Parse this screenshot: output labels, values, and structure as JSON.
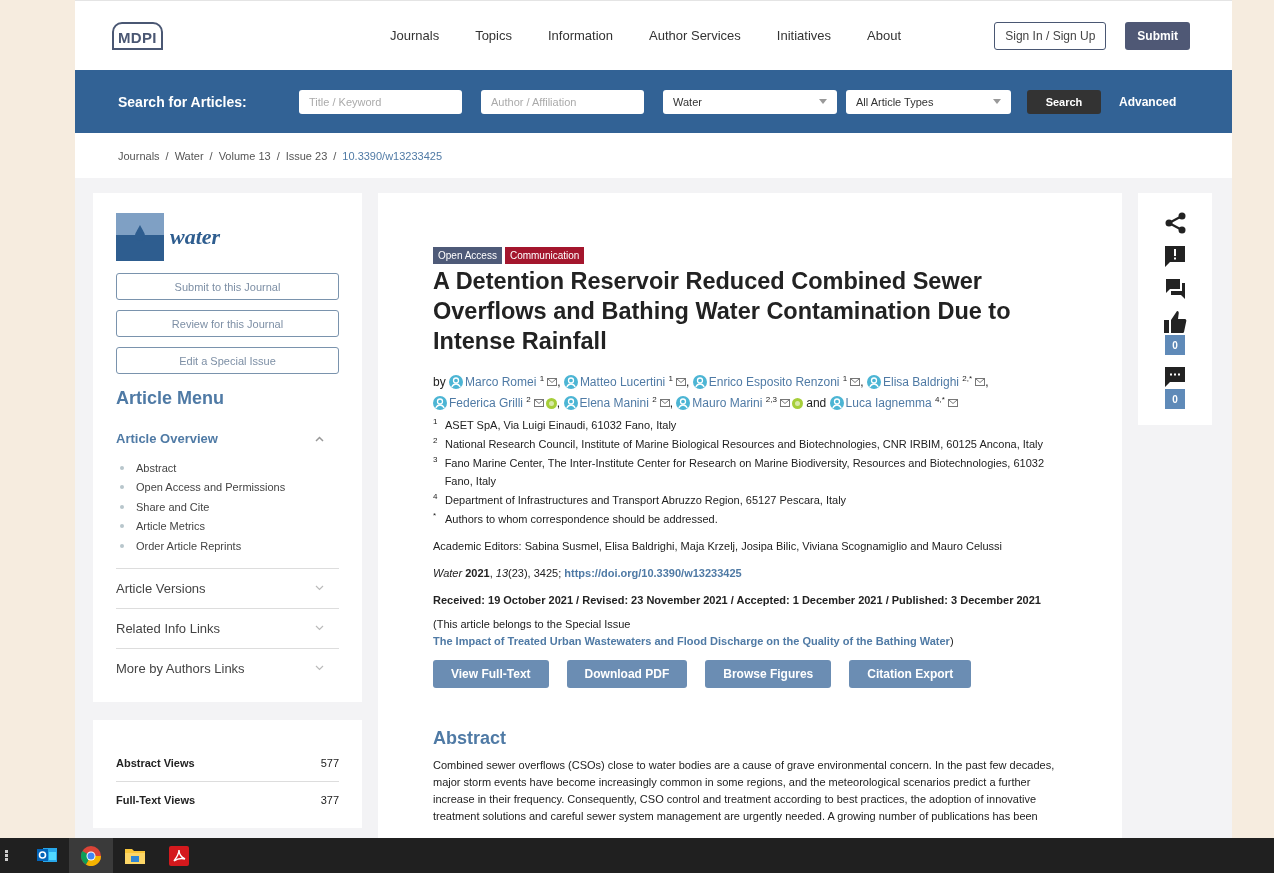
{
  "header": {
    "logo": "MDPI",
    "nav": [
      "Journals",
      "Topics",
      "Information",
      "Author Services",
      "Initiatives",
      "About"
    ],
    "sign_in": "Sign In / Sign Up",
    "submit": "Submit"
  },
  "search": {
    "label": "Search for Articles:",
    "fields": [
      {
        "kind": "input",
        "placeholder": "Title / Keyword"
      },
      {
        "kind": "input",
        "placeholder": "Author / Affiliation"
      },
      {
        "kind": "select",
        "value": "Water"
      },
      {
        "kind": "select",
        "value": "All Article Types"
      }
    ],
    "button": "Search",
    "advanced": "Advanced"
  },
  "breadcrumb": {
    "separator": "/",
    "items": [
      {
        "label": "Journals",
        "current": false
      },
      {
        "label": "Water",
        "current": false
      },
      {
        "label": "Volume 13",
        "current": false
      },
      {
        "label": "Issue 23",
        "current": false
      },
      {
        "label": "10.3390/w13233425",
        "current": true
      }
    ]
  },
  "sidebar": {
    "journal": "water",
    "buttons": [
      "Submit to this Journal",
      "Review for this Journal",
      "Edit a Special Issue"
    ],
    "menu_title": "Article Menu",
    "sections": [
      {
        "label": "Article Overview",
        "expanded": true,
        "items": [
          "Abstract",
          "Open Access and Permissions",
          "Share and Cite",
          "Article Metrics",
          "Order Article Reprints"
        ]
      },
      {
        "label": "Article Versions",
        "expanded": false
      },
      {
        "label": "Related Info Links",
        "expanded": false
      },
      {
        "label": "More by Authors Links",
        "expanded": false
      }
    ]
  },
  "stats": [
    {
      "label": "Abstract Views",
      "value": "577"
    },
    {
      "label": "Full-Text Views",
      "value": "377"
    }
  ],
  "article": {
    "badges": [
      {
        "label": "Open Access",
        "color": "#4e5a78"
      },
      {
        "label": "Communication",
        "color": "#a4162d"
      }
    ],
    "title": "A Detention Reservoir Reduced Combined Sewer Overflows and Bathing Water Contamination Due to Intense Rainfall",
    "by": "by",
    "authors": [
      {
        "name": "Marco Romei",
        "sup": "1",
        "orcid": false,
        "sep": ","
      },
      {
        "name": "Matteo Lucertini",
        "sup": "1",
        "orcid": false,
        "sep": ","
      },
      {
        "name": "Enrico Esposito Renzoni",
        "sup": "1",
        "orcid": false,
        "sep": ","
      },
      {
        "name": "Elisa Baldrighi",
        "sup": "2,*",
        "orcid": false,
        "sep": ","
      },
      {
        "name": "Federica Grilli",
        "sup": "2",
        "orcid": true,
        "sep": ","
      },
      {
        "name": "Elena Manini",
        "sup": "2",
        "orcid": false,
        "sep": ","
      },
      {
        "name": "Mauro Marini",
        "sup": "2,3",
        "orcid": true,
        "sep": "and"
      },
      {
        "name": "Luca Iagnemma",
        "sup": "4,*",
        "orcid": false
      }
    ],
    "affiliations": [
      {
        "mark": "1",
        "text": "ASET SpA, Via Luigi Einaudi, 61032 Fano, Italy"
      },
      {
        "mark": "2",
        "text": "National Research Council, Institute of Marine Biological Resources and Biotechnologies, CNR IRBIM, 60125 Ancona, Italy"
      },
      {
        "mark": "3",
        "text": "Fano Marine Center, The Inter-Institute Center for Research on Marine Biodiversity, Resources and Biotechnologies, 61032 Fano, Italy"
      },
      {
        "mark": "4",
        "text": "Department of Infrastructures and Transport Abruzzo Region, 65127 Pescara, Italy"
      },
      {
        "mark": "*",
        "text": "Authors to whom correspondence should be addressed."
      }
    ],
    "editors": "Academic Editors: Sabina Susmel, Elisa Baldrighi, Maja Krzelj, Josipa Bilic, Viviana Scognamiglio and Mauro Celussi",
    "citation": "*Water* **2021**, *13*(23), 3425;",
    "doi": "https://doi.org/10.3390/w13233425",
    "dates": "Received: 19 October 2021 / Revised: 23 November 2021 / Accepted: 1 December 2021 / Published: 3 December 2021",
    "special_issue": {
      "before": "(This article belongs to the Special Issue",
      "link": "The Impact of Treated Urban Wastewaters and Flood Discharge on the Quality of the Bathing Water",
      "after": ")"
    },
    "actions": [
      "View Full-Text",
      "Download PDF",
      "Browse Figures",
      "Citation Export"
    ],
    "abstract_title": "Abstract",
    "abstract": "Combined sewer overflows (CSOs) close to water bodies are a cause of grave environmental concern. In the past few decades, major storm events have become increasingly common in some regions, and the meteorological scenarios predict a further increase in their frequency. Consequently, CSO control and treatment according to best practices, the adoption of innovative treatment solutions and careful sewer system management are urgently needed. A growing number of publications has been"
  },
  "side_tools": [
    {
      "kind": "share"
    },
    {
      "kind": "report"
    },
    {
      "kind": "comments"
    },
    {
      "kind": "like",
      "count": "0"
    },
    {
      "kind": "comment",
      "count": "0"
    }
  ],
  "taskbar": [
    {
      "kind": "mail",
      "selected": false
    },
    {
      "kind": "browser",
      "selected": true
    },
    {
      "kind": "folder",
      "selected": false
    },
    {
      "kind": "pdf",
      "selected": false
    }
  ]
}
